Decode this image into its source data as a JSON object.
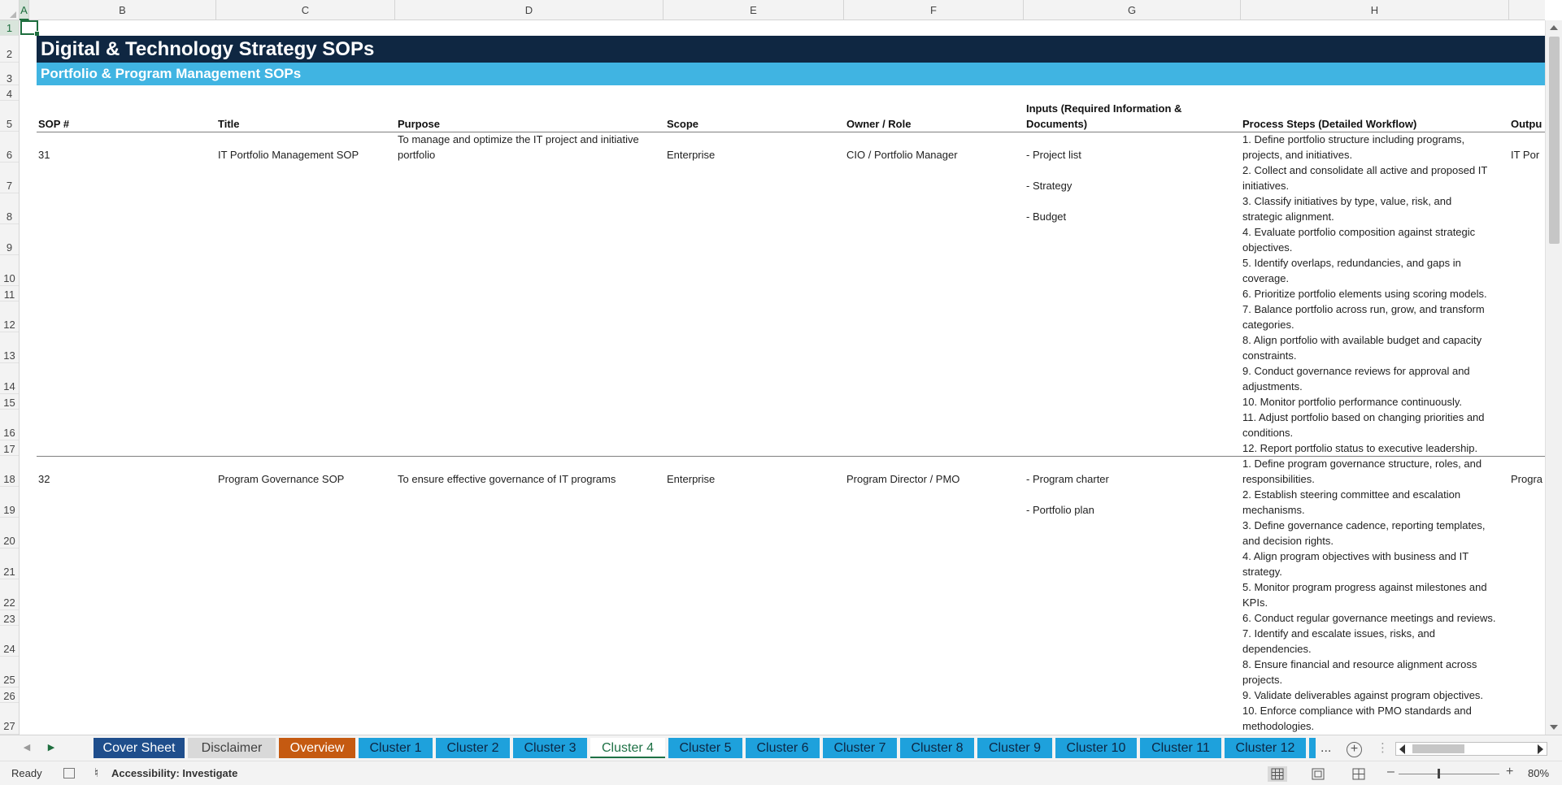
{
  "columns": [
    "A",
    "B",
    "C",
    "D",
    "E",
    "F",
    "G",
    "H"
  ],
  "rows": [
    "1",
    "2",
    "3",
    "4",
    "5",
    "6",
    "7",
    "8",
    "9",
    "10",
    "11",
    "12",
    "13",
    "14",
    "15",
    "16",
    "17",
    "18",
    "19",
    "20",
    "21",
    "22",
    "23",
    "24",
    "25",
    "26",
    "27"
  ],
  "banner": {
    "title": "Digital & Technology Strategy SOPs",
    "subtitle": "Portfolio & Program Management SOPs"
  },
  "headers": {
    "sop": "SOP #",
    "title": "Title",
    "purpose": "Purpose",
    "scope": "Scope",
    "owner": "Owner / Role",
    "inputs_1": "Inputs (Required Information &",
    "inputs_2": "Documents)",
    "process": "Process Steps (Detailed Workflow)",
    "outputs": "Outpu"
  },
  "sops": [
    {
      "num": "31",
      "title": "IT Portfolio Management SOP",
      "purpose_1": "To manage and optimize the IT project and initiative",
      "purpose_2": "portfolio",
      "scope": "Enterprise",
      "owner": "CIO / Portfolio Manager",
      "inputs": [
        "- Project list",
        "- Strategy",
        "- Budget"
      ],
      "output": "IT Por",
      "steps": [
        "1. Define portfolio structure including programs,",
        "projects, and initiatives.",
        "2. Collect and consolidate all active and proposed IT",
        "initiatives.",
        "3. Classify initiatives by type, value, risk, and",
        "strategic alignment.",
        "4. Evaluate portfolio composition against strategic",
        "objectives.",
        "5. Identify overlaps, redundancies, and gaps in",
        "coverage.",
        "6. Prioritize portfolio elements using scoring models.",
        "7. Balance portfolio across run, grow, and transform",
        "categories.",
        "8. Align portfolio with available budget and capacity",
        "constraints.",
        "9. Conduct governance reviews for approval and",
        "adjustments.",
        "10. Monitor portfolio performance continuously.",
        "11. Adjust portfolio based on changing priorities and",
        "conditions.",
        "12. Report portfolio status to executive leadership."
      ]
    },
    {
      "num": "32",
      "title": "Program Governance SOP",
      "purpose_1": "To ensure effective governance of IT programs",
      "scope": "Enterprise",
      "owner": "Program Director / PMO",
      "inputs": [
        "- Program charter",
        "- Portfolio plan"
      ],
      "output": "Progra",
      "steps": [
        "1. Define program governance structure, roles, and",
        "responsibilities.",
        "2. Establish steering committee and escalation",
        "mechanisms.",
        "3. Define governance cadence, reporting templates,",
        "and decision rights.",
        "4. Align program objectives with business and IT",
        "strategy.",
        "5. Monitor program progress against milestones and",
        "KPIs.",
        "6. Conduct regular governance meetings and reviews.",
        "7. Identify and escalate issues, risks, and",
        "dependencies.",
        "8. Ensure financial and resource alignment across",
        "projects.",
        "9. Validate deliverables against program objectives.",
        "10. Enforce compliance with PMO standards and",
        "methodologies."
      ]
    }
  ],
  "tabs": [
    {
      "label": "Cover Sheet",
      "bg": "#1f4e8c",
      "fg": "#ffffff"
    },
    {
      "label": "Disclaimer",
      "bg": "#d9d9d9",
      "fg": "#404040"
    },
    {
      "label": "Overview",
      "bg": "#c55a11",
      "fg": "#ffffff"
    },
    {
      "label": "Cluster 1",
      "bg": "#1ea1dc",
      "fg": "#0c2744"
    },
    {
      "label": "Cluster 2",
      "bg": "#1ea1dc",
      "fg": "#0c2744"
    },
    {
      "label": "Cluster 3",
      "bg": "#1ea1dc",
      "fg": "#0c2744"
    },
    {
      "label": "Cluster 4",
      "bg": "#ffffff",
      "fg": "#1e7145"
    },
    {
      "label": "Cluster 5",
      "bg": "#1ea1dc",
      "fg": "#0c2744"
    },
    {
      "label": "Cluster 6",
      "bg": "#1ea1dc",
      "fg": "#0c2744"
    },
    {
      "label": "Cluster 7",
      "bg": "#1ea1dc",
      "fg": "#0c2744"
    },
    {
      "label": "Cluster 8",
      "bg": "#1ea1dc",
      "fg": "#0c2744"
    },
    {
      "label": "Cluster 9",
      "bg": "#1ea1dc",
      "fg": "#0c2744"
    },
    {
      "label": "Cluster 10",
      "bg": "#1ea1dc",
      "fg": "#0c2744"
    },
    {
      "label": "Cluster 11",
      "bg": "#1ea1dc",
      "fg": "#0c2744"
    },
    {
      "label": "Cluster 12",
      "bg": "#1ea1dc",
      "fg": "#0c2744"
    }
  ],
  "tab_overflow": "...",
  "active_tab": "Cluster 4",
  "status": {
    "ready": "Ready",
    "accessibility": "Accessibility: Investigate",
    "zoom": "80%",
    "zoom_level": 0.8
  },
  "colors": {
    "banner_dark": "#0f2742",
    "banner_light": "#40b4e2",
    "selection_green": "#1e6e3e"
  }
}
